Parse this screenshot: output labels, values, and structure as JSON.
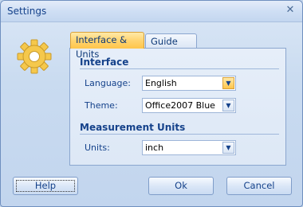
{
  "window": {
    "title": "Settings",
    "close_glyph": "✕"
  },
  "icon": {
    "name": "gear-icon",
    "color": "#f5c84c"
  },
  "tabs": [
    {
      "label": "Interface & Units",
      "active": true
    },
    {
      "label": "Guide Lines",
      "active": false
    }
  ],
  "interface": {
    "heading": "Interface",
    "language": {
      "label": "Language:",
      "value": "English"
    },
    "theme": {
      "label": "Theme:",
      "value": "Office2007 Blue"
    }
  },
  "measurement": {
    "heading": "Measurement Units",
    "units": {
      "label": "Units:",
      "value": "inch"
    }
  },
  "buttons": {
    "help": "Help",
    "ok": "Ok",
    "cancel": "Cancel"
  },
  "colors": {
    "accent": "#ffc54a",
    "text": "#15428b",
    "frame": "#c2d5ee"
  }
}
